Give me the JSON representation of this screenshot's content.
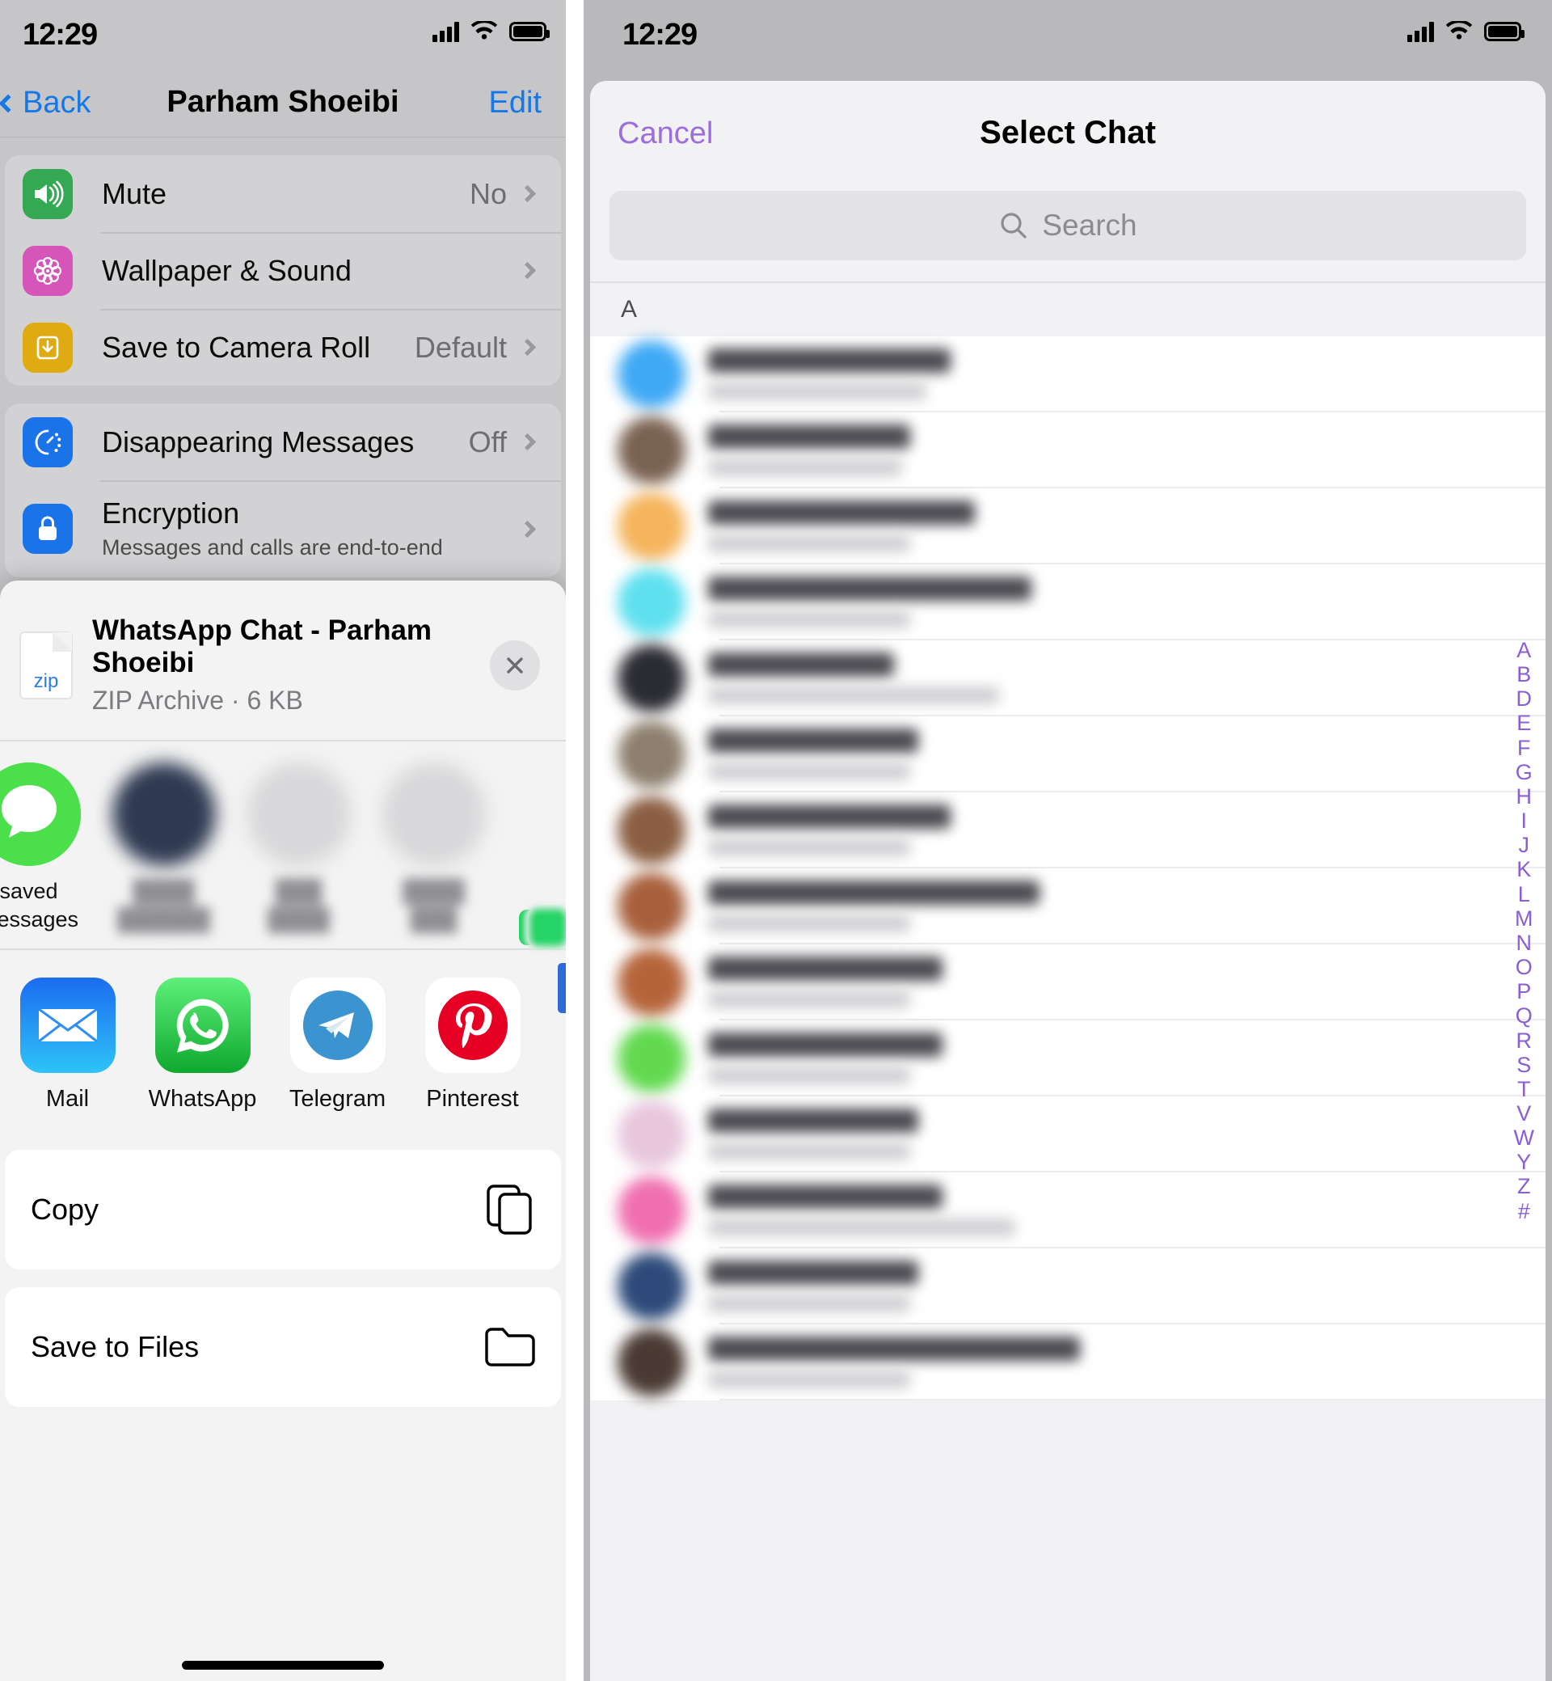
{
  "left": {
    "status": {
      "time": "12:29"
    },
    "nav": {
      "back": "Back",
      "title": "Parham Shoeibi",
      "edit": "Edit"
    },
    "groups": [
      {
        "rows": [
          {
            "icon": "speaker-icon",
            "color": "#34a853",
            "label": "Mute",
            "value": "No",
            "chevron": true
          },
          {
            "icon": "flower-icon",
            "color": "#d555b8",
            "label": "Wallpaper & Sound",
            "value": "",
            "chevron": true
          },
          {
            "icon": "download-icon",
            "color": "#e0ab12",
            "label": "Save to Camera Roll",
            "value": "Default",
            "chevron": true
          }
        ]
      },
      {
        "rows": [
          {
            "icon": "timer-icon",
            "color": "#1a73e8",
            "label": "Disappearing Messages",
            "value": "Off",
            "chevron": true
          },
          {
            "icon": "lock-icon",
            "color": "#1a73e8",
            "label": "Encryption",
            "sub": "Messages and calls are end-to-end",
            "value": "",
            "chevron": true
          }
        ]
      }
    ]
  },
  "share_sheet": {
    "file": {
      "badge": "zip",
      "name": "WhatsApp Chat - Parham Shoeibi",
      "meta": "ZIP Archive · 6 KB",
      "close_icon": "close-icon"
    },
    "people": [
      {
        "label": "",
        "avatar_color": "#9fc2d8",
        "badge": "whatsapp-icon",
        "blurred": true,
        "partial": true
      },
      {
        "label": "saved messages",
        "avatar_color": "#4ee04e",
        "badge": "whatsapp-icon",
        "blurred": false
      },
      {
        "label": "",
        "avatar_color": "#2f3a52",
        "badge": "whatsapp-icon",
        "blurred": true
      },
      {
        "label": "",
        "avatar_color": "#d6d6d8",
        "badge": "whatsapp-icon",
        "blurred": true
      },
      {
        "label": "",
        "avatar_color": "#d6d6d8",
        "badge": "whatsapp-icon",
        "blurred": true
      }
    ],
    "apps": [
      {
        "label": "Mail",
        "icon": "mail-icon"
      },
      {
        "label": "WhatsApp",
        "icon": "whatsapp-icon"
      },
      {
        "label": "Telegram",
        "icon": "telegram-icon"
      },
      {
        "label": "Pinterest",
        "icon": "pinterest-icon"
      }
    ],
    "actions": [
      {
        "label": "Copy",
        "icon": "copy-icon"
      },
      {
        "label": "Save to Files",
        "icon": "folder-icon"
      }
    ]
  },
  "right": {
    "status": {
      "time": "12:29"
    },
    "nav": {
      "cancel": "Cancel",
      "title": "Select Chat"
    },
    "search": {
      "placeholder": "Search",
      "icon": "search-icon"
    },
    "section_header": "A",
    "index_letters": [
      "A",
      "B",
      "D",
      "E",
      "F",
      "G",
      "H",
      "I",
      "J",
      "K",
      "L",
      "M",
      "N",
      "O",
      "P",
      "Q",
      "R",
      "S",
      "T",
      "V",
      "W",
      "Y",
      "Z",
      "#"
    ],
    "chats": [
      {
        "avatar_color": "#3fa9f5",
        "name_w": 300,
        "msg_w": 270
      },
      {
        "avatar_color": "#7a6252",
        "name_w": 250,
        "msg_w": 240
      },
      {
        "avatar_color": "#f5b45c",
        "name_w": 330,
        "msg_w": 250
      },
      {
        "avatar_color": "#5fe0ef",
        "name_w": 400,
        "msg_w": 250
      },
      {
        "avatar_color": "#2b2b33",
        "name_w": 230,
        "msg_w": 360
      },
      {
        "avatar_color": "#8d7f6e",
        "name_w": 260,
        "msg_w": 250
      },
      {
        "avatar_color": "#8a5e42",
        "name_w": 300,
        "msg_w": 250
      },
      {
        "avatar_color": "#a8603c",
        "name_w": 410,
        "msg_w": 250
      },
      {
        "avatar_color": "#b5643a",
        "name_w": 290,
        "msg_w": 250
      },
      {
        "avatar_color": "#62d94f",
        "name_w": 290,
        "msg_w": 250
      },
      {
        "avatar_color": "#e8c6dd",
        "name_w": 260,
        "msg_w": 250
      },
      {
        "avatar_color": "#f06fb0",
        "name_w": 290,
        "msg_w": 380
      },
      {
        "avatar_color": "#2d4a7a",
        "name_w": 260,
        "msg_w": 250
      },
      {
        "avatar_color": "#4a3a33",
        "name_w": 460,
        "msg_w": 250
      }
    ]
  }
}
